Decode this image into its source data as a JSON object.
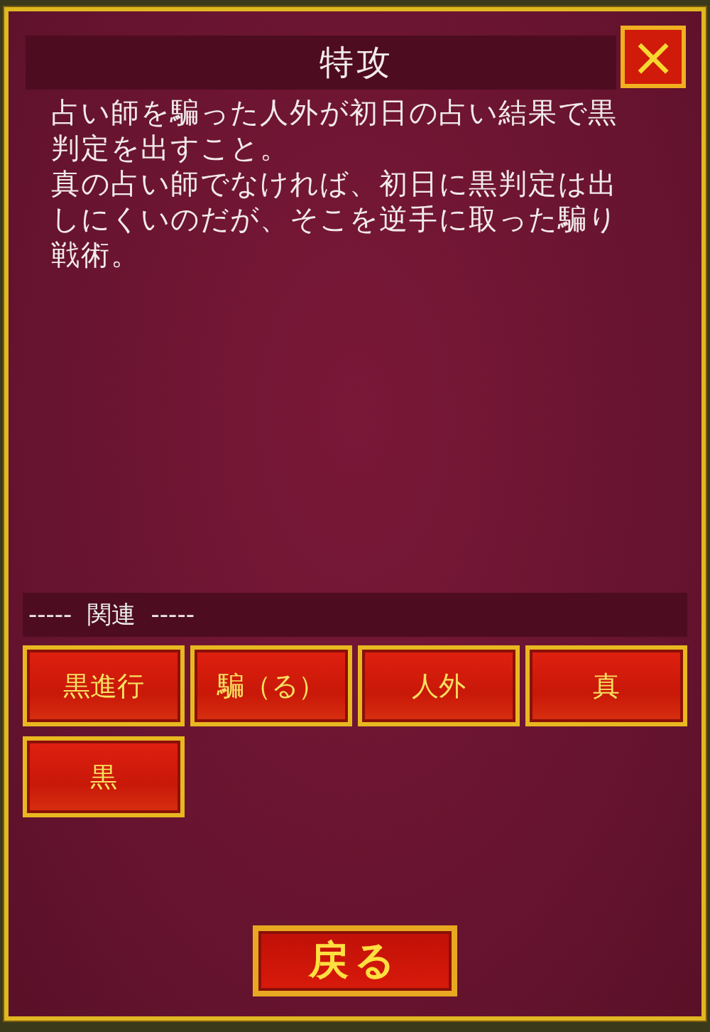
{
  "title": "特攻",
  "close_button": {
    "label": "×"
  },
  "description": [
    "占い師を騙った人外が初日の占い結果で黒判定を出すこと。",
    "真の占い師でなければ、初日に黒判定は出しにくいのだが、そこを逆手に取った騙り戦術。"
  ],
  "related": {
    "heading": "-----  関連  -----",
    "items": [
      "黒進行",
      "騙（る）",
      "人外",
      "真",
      "黒"
    ]
  },
  "back_button": {
    "label": "戻る"
  }
}
